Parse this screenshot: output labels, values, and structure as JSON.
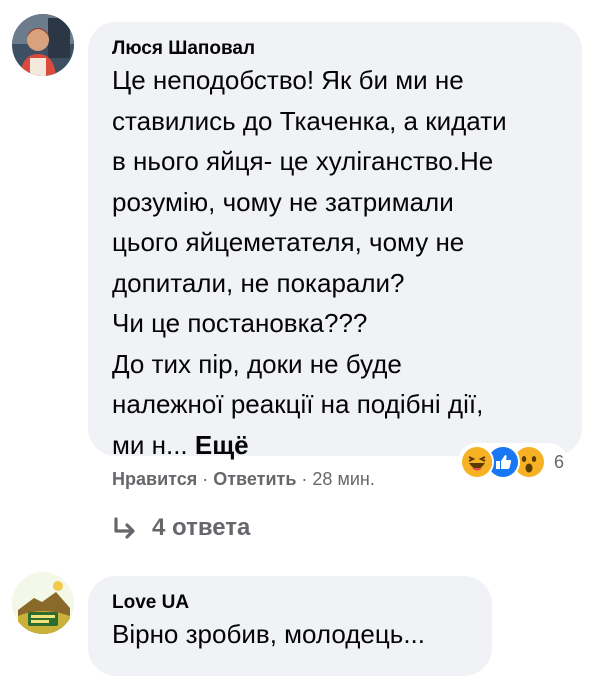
{
  "comments": [
    {
      "author": "Люся Шаповал",
      "text_lines": [
        "Це неподобство! Як би ми не",
        "ставились до Ткаченка, а кидати",
        "в нього яйця- це хуліганство.Не",
        "розумію, чому не затримали",
        "цього яйцеметателя, чому не",
        "допитали, не покарали?",
        "Чи це постановка???",
        "До тих пір, доки не буде",
        "належної реакції на подібні дії,",
        "ми н..."
      ],
      "see_more": "Ещё",
      "like_label": "Нравится",
      "reply_label": "Ответить",
      "separator": "·",
      "timestamp": "28 мин.",
      "reactions": {
        "icons": [
          "haha-icon",
          "like-icon",
          "wow-icon"
        ],
        "count": "6"
      },
      "replies_label": "4 ответа"
    },
    {
      "author": "Love UA",
      "text_lines": [
        "Вірно зробив, молодець..."
      ]
    }
  ],
  "colors": {
    "bubble": "#f0f2f5",
    "secondary_text": "#65676b",
    "like_blue": "#1877f2",
    "reaction_yellow": "#f7b125"
  }
}
